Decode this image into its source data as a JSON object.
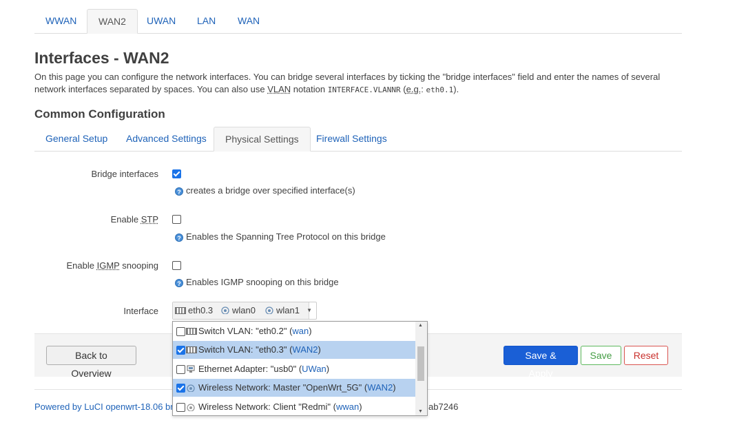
{
  "top_tabs": [
    {
      "label": "WWAN"
    },
    {
      "label": "WAN2"
    },
    {
      "label": "UWAN"
    },
    {
      "label": "LAN"
    },
    {
      "label": "WAN"
    }
  ],
  "page": {
    "title": "Interfaces - WAN2",
    "desc_1": "On this page you can configure the network interfaces. You can bridge several interfaces by ticking the \"bridge interfaces\" field and enter the names of several network interfaces separated by spaces. You can also use ",
    "desc_vlan": "VLAN",
    "desc_2": " notation ",
    "desc_code1": "INTERFACE.VLANNR",
    "desc_3": " (",
    "desc_eg": "e.g.",
    "desc_4": ": ",
    "desc_code2": "eth0.1",
    "desc_5": ")."
  },
  "section": {
    "title": "Common Configuration"
  },
  "sub_tabs": [
    {
      "label": "General Setup"
    },
    {
      "label": "Advanced Settings"
    },
    {
      "label": "Physical Settings"
    },
    {
      "label": "Firewall Settings"
    }
  ],
  "fields": {
    "bridge": {
      "label": "Bridge interfaces",
      "checked": true,
      "help": "creates a bridge over specified interface(s)"
    },
    "stp": {
      "label_pre": "Enable ",
      "label_abbr": "STP",
      "checked": false,
      "help": "Enables the Spanning Tree Protocol on this bridge"
    },
    "igmp": {
      "label_pre": "Enable ",
      "label_abbr": "IGMP",
      "label_post": " snooping",
      "checked": false,
      "help": "Enables IGMP snooping on this bridge"
    },
    "interface": {
      "label": "Interface",
      "chips": [
        "eth0.3",
        "wlan0",
        "wlan1"
      ],
      "caret": "▼"
    }
  },
  "dropdown_options": [
    {
      "text": "Switch VLAN: \"eth0.2\" (",
      "zone": "wan",
      "close": ")",
      "checked": false,
      "icon": "switch-icon"
    },
    {
      "text": "Switch VLAN: \"eth0.3\" (",
      "zone": "WAN2",
      "close": ")",
      "checked": true,
      "icon": "switch-icon"
    },
    {
      "text": "Ethernet Adapter: \"usb0\" (",
      "zone": "UWan",
      "close": ")",
      "checked": false,
      "icon": "ethernet-icon"
    },
    {
      "text": "Wireless Network: Master \"OpenWrt_5G\" (",
      "zone": "WAN2",
      "close": ")",
      "checked": true,
      "icon": "wifi-icon"
    },
    {
      "text": "Wireless Network: Client \"Redmi\" (",
      "zone": "wwan",
      "close": ")",
      "checked": false,
      "icon": "wifi-icon"
    }
  ],
  "actions": {
    "back": "Back to Overview",
    "save_apply": "Save & Apply",
    "save": "Save",
    "reset": "Reset"
  },
  "footer": {
    "link": "Powered by LuCI openwrt-18.06 br",
    "tail": "ab7246"
  },
  "colors": {
    "link": "#1e62b8",
    "primary": "#1a5fd6",
    "selected_row": "#b8d2f0",
    "checkbox": "#1a73e8"
  }
}
